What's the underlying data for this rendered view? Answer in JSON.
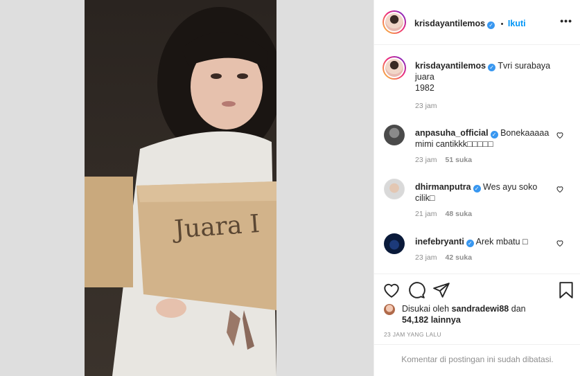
{
  "post": {
    "author": "krisdayantilemos",
    "follow_sep": "•",
    "follow_label": "Ikuti",
    "more_icon": "more-options-icon",
    "caption_lines": [
      "Tvri surabaya",
      "juara",
      "1982"
    ],
    "caption_time": "23 jam",
    "photo_text": "Juara I"
  },
  "comments": [
    {
      "user": "anpasuha_official",
      "text_lines": [
        "Bonekaaaaa",
        "mimi cantikkk□□□□□"
      ],
      "time": "23 jam",
      "likes": "51 suka"
    },
    {
      "user": "dhirmanputra",
      "text_lines": [
        "Wes ayu soko",
        "cilik□"
      ],
      "time": "21 jam",
      "likes": "48 suka"
    },
    {
      "user": "inefebryanti",
      "text_lines": [
        "Arek mbatu □"
      ],
      "time": "23 jam",
      "likes": "42 suka"
    }
  ],
  "footer": {
    "liked_by_prefix": "Disukai oleh",
    "liked_by_user": "sandradewi88",
    "liked_by_and": "dan",
    "liked_count": "54,182 lainnya",
    "time_ago": "23 JAM YANG LALU",
    "comments_closed": "Komentar di postingan ini sudah dibatasi."
  },
  "colors": {
    "accent": "#0095f6",
    "verified": "#3897f0",
    "muted": "#8e8e8e",
    "text": "#262626",
    "backdrop": "#dedede"
  }
}
